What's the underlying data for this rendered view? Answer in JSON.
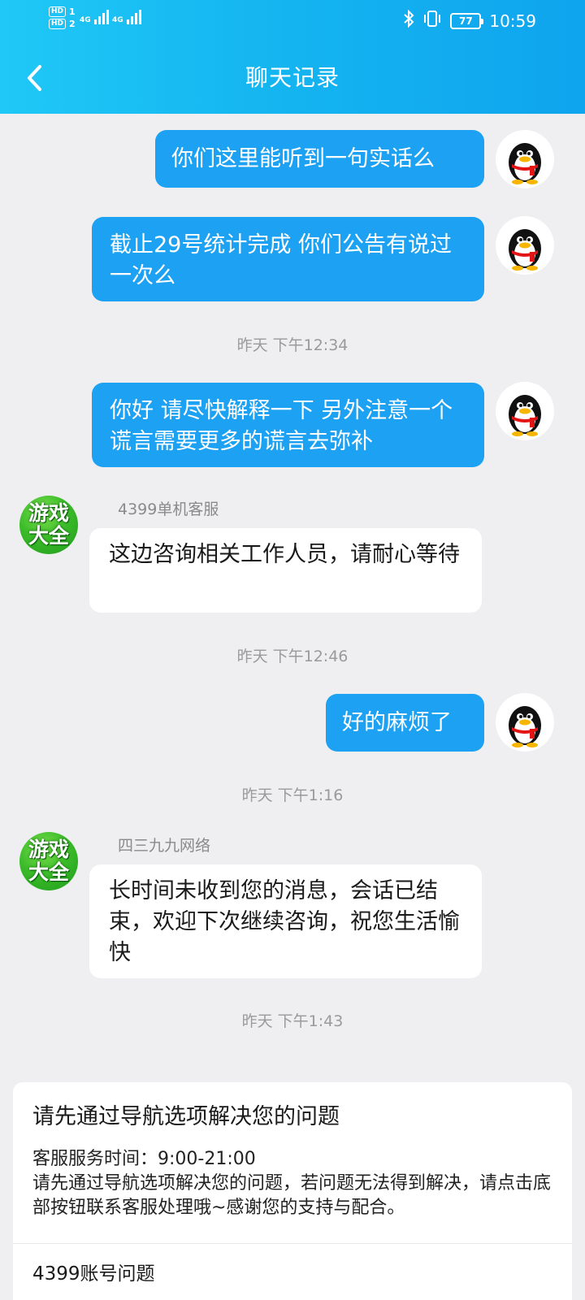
{
  "status_bar": {
    "hd1": "HD",
    "hd1_num": "1",
    "hd2": "HD",
    "hd2_num": "2",
    "net1": "4G",
    "net2": "4G",
    "battery": "77",
    "time": "10:59"
  },
  "header": {
    "title": "聊天记录"
  },
  "messages": {
    "m1": "你们这里能听到一句实话么",
    "m2": "截止29号统计完成 你们公告有说过一次么",
    "t1": "昨天  下午12:34",
    "m3": "你好  请尽快解释一下 另外注意一个谎言需要更多的谎言去弥补",
    "s1": "4399单机客服",
    "m4": "这边咨询相关工作人员，请耐心等待",
    "t2": "昨天  下午12:46",
    "m5": "好的麻烦了",
    "t3": "昨天  下午1:16",
    "s2": "四三九九网络",
    "m6": "长时间未收到您的消息，会话已结束，欢迎下次继续咨询，祝您生活愉快",
    "t4": "昨天  下午1:43"
  },
  "avatar_game": {
    "line1": "游戏",
    "line2": "大全"
  },
  "card": {
    "title": "请先通过导航选项解决您的问题",
    "hours": "客服服务时间：9:00-21:00",
    "body": "请先通过导航选项解决您的问题，若问题无法得到解决，请点击底部按钮联系客服处理哦~感谢您的支持与配合。",
    "item1": "4399账号问题"
  },
  "colors": {
    "header": "#14b4f0",
    "bubble_out": "#1da1f2",
    "background": "#efeff2"
  }
}
